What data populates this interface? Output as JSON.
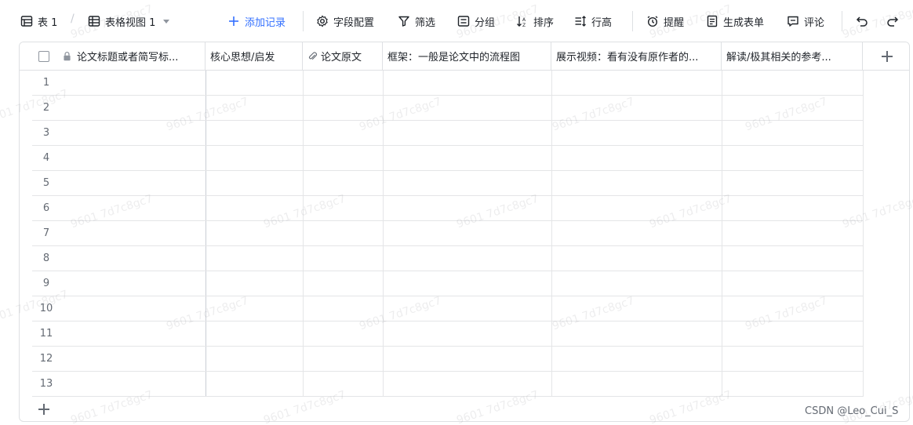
{
  "toolbar": {
    "table_name": "表 1",
    "view_name": "表格视图 1",
    "add_record": "添加记录",
    "field_config": "字段配置",
    "filter": "筛选",
    "group": "分组",
    "sort": "排序",
    "row_height": "行高",
    "remind": "提醒",
    "generate_form": "生成表单",
    "comment": "评论"
  },
  "columns": [
    {
      "label": "论文标题或者简写标..."
    },
    {
      "label": "核心思想/启发"
    },
    {
      "label": "论文原文"
    },
    {
      "label": "框架：一般是论文中的流程图"
    },
    {
      "label": "展示视频：看有没有原作者的..."
    },
    {
      "label": "解读/极其相关的参考..."
    }
  ],
  "rows": [
    "1",
    "2",
    "3",
    "4",
    "5",
    "6",
    "7",
    "8",
    "9",
    "10",
    "11",
    "12",
    "13"
  ],
  "watermark": "9601 7d7c8gc7",
  "footer_credit": "CSDN @Leo_Cui_S",
  "colors": {
    "accent": "#3370ff",
    "border": "#dee0e3",
    "text": "#1f2329",
    "muted": "#646a73"
  }
}
